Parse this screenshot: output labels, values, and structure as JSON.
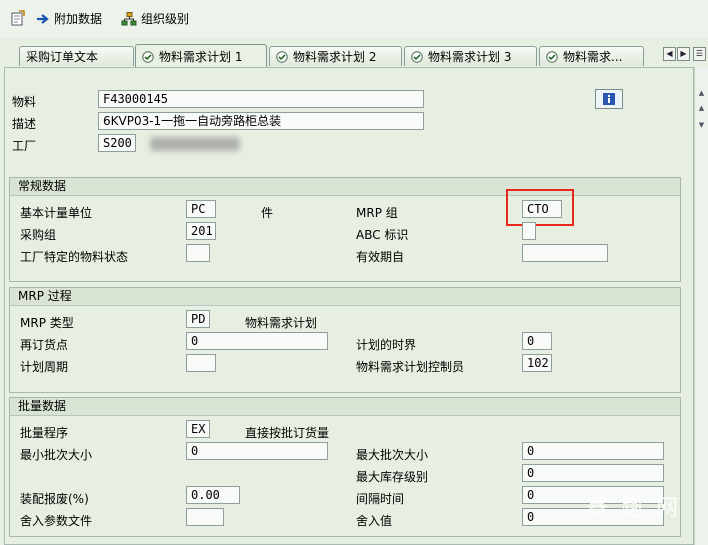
{
  "toolbar": {
    "additional_data": "附加数据",
    "org_levels": "组织级别"
  },
  "tabs": [
    {
      "label": "采购订单文本"
    },
    {
      "label": "物料需求计划 1"
    },
    {
      "label": "物料需求计划 2"
    },
    {
      "label": "物料需求计划 3"
    },
    {
      "label": "物料需求..."
    }
  ],
  "header": {
    "material_label": "物料",
    "material_value": "F43000145",
    "desc_label": "描述",
    "desc_value": "6KVP03-1一拖一自动旁路柜总装",
    "plant_label": "工厂",
    "plant_value": "S200"
  },
  "general": {
    "title": "常规数据",
    "base_uom_label": "基本计量单位",
    "base_uom_value": "PC",
    "base_uom_text": "件",
    "mrp_group_label": "MRP 组",
    "mrp_group_value": "CTO",
    "purch_group_label": "采购组",
    "purch_group_value": "201",
    "abc_label": "ABC 标识",
    "abc_value": "",
    "plant_status_label": "工厂特定的物料状态",
    "plant_status_value": "",
    "valid_from_label": "有效期自",
    "valid_from_value": ""
  },
  "mrp_proc": {
    "title": "MRP 过程",
    "mrp_type_label": "MRP 类型",
    "mrp_type_value": "PD",
    "mrp_type_text": "物料需求计划",
    "reorder_label": "再订货点",
    "reorder_value": "0",
    "plan_fence_label": "计划的时界",
    "plan_fence_value": "0",
    "plan_cycle_label": "计划周期",
    "plan_cycle_value": "",
    "controller_label": "物料需求计划控制员",
    "controller_value": "102"
  },
  "lot": {
    "title": "批量数据",
    "lot_proc_label": "批量程序",
    "lot_proc_value": "EX",
    "lot_proc_text": "直接按批订货量",
    "min_lot_label": "最小批次大小",
    "min_lot_value": "0",
    "max_lot_label": "最大批次大小",
    "max_lot_value": "0",
    "max_stock_label": "最大库存级别",
    "max_stock_value": "0",
    "assembly_scrap_label": "装配报废(%)",
    "assembly_scrap_value": "0.00",
    "interval_label": "间隔时间",
    "interval_value": "0",
    "rounding_profile_label": "舍入参数文件",
    "rounding_profile_value": "",
    "rounding_value_label": "舍入值",
    "rounding_value_value": "0"
  },
  "watermark": "赛 跑 网",
  "colors": {
    "highlight": "#e8281d",
    "background": "#e6efe1",
    "group_header": "#d9e4d4"
  }
}
